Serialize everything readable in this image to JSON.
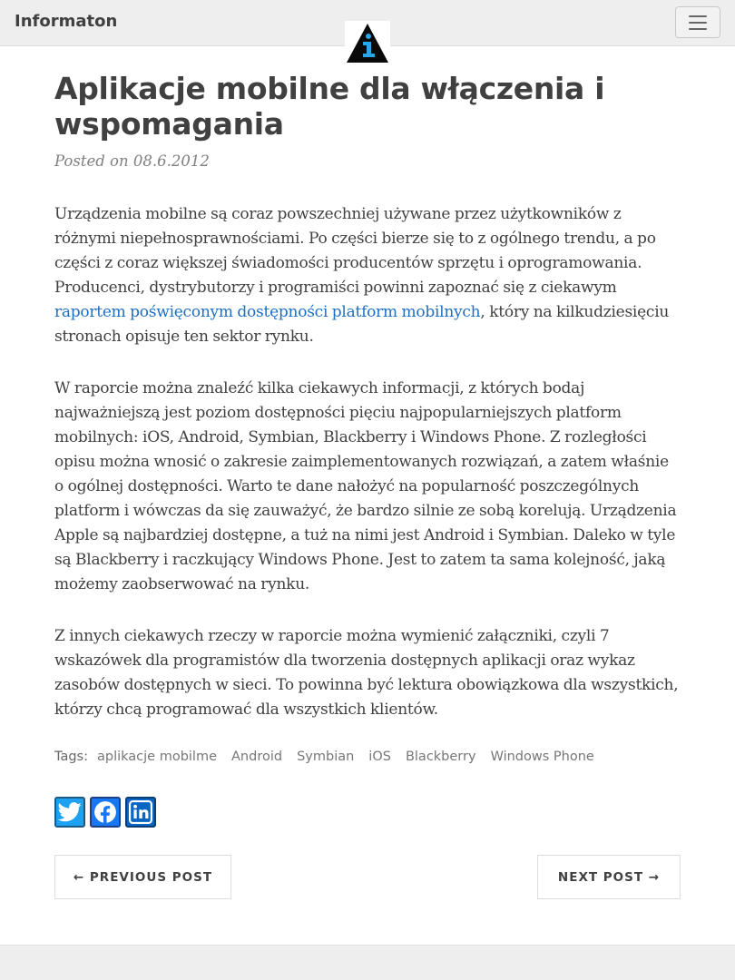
{
  "nav": {
    "brand": "Informaton",
    "toggle_label": "toggle-navigation"
  },
  "post": {
    "title": "Aplikacje mobilne dla włączenia i wspomagania",
    "meta_prefix": "Posted on",
    "date": "08.6.2012",
    "p1_before": "Urządzenia mobilne są coraz powszechniej używane przez użytkowników z różnymi niepełnosprawnościami. Po części bierze się to z ogólnego trendu, a po części z coraz większej świadomości producentów sprzętu i oprogramowania. Producenci, dystrybutorzy i programiści powinni zapoznać się z ciekawym ",
    "p1_link": "raportem poświęconym dostępności platform mobilnych",
    "p1_after": ", który na kilkudziesięciu stronach opisuje ten sektor rynku.",
    "p2": "W raporcie można znaleźć kilka ciekawych informacji, z których bodaj najważniejszą jest poziom dostępności pięciu najpopularniejszych platform mobilnych: iOS, Android, Symbian, Blackberry i Windows Phone. Z rozległości opisu można wnosić o zakresie zaimplementowanych rozwiązań, a zatem właśnie o ogólnej dostępności. Warto te dane nałożyć na popularność poszczególnych platform i wówczas da się zauważyć, że bardzo silnie ze sobą korelują. Urządzenia Apple są najbardziej dostępne, a tuż na nimi jest Android i Symbian. Daleko w tyle są Blackberry i raczkujący Windows Phone. Jest to zatem ta sama kolejność, jaką możemy zaobserwować na rynku.",
    "p3": "Z innych ciekawych rzeczy w raporcie można wymienić załączniki, czyli 7 wskazówek dla programistów dla tworzenia dostępnych aplikacji oraz wykaz zasobów dostępnych w sieci. To powinna być lektura obowiązkowa dla wszystkich, którzy chcą programować dla wszystkich klientów."
  },
  "tags": {
    "label": "Tags:",
    "items": [
      "aplikacje mobilme",
      "Android",
      "Symbian",
      "iOS",
      "Blackberry",
      "Windows Phone"
    ]
  },
  "share": {
    "icons": [
      "twitter-icon",
      "facebook-icon",
      "linkedin-icon"
    ]
  },
  "pager": {
    "previous": "← PREVIOUS POST",
    "next": "NEXT POST →"
  },
  "colors": {
    "link": "#1e6fc3",
    "navbar_bg": "#eeeeee",
    "twitter": "#1da1f2",
    "facebook": "#1877f2",
    "linkedin": "#0a66c2"
  }
}
